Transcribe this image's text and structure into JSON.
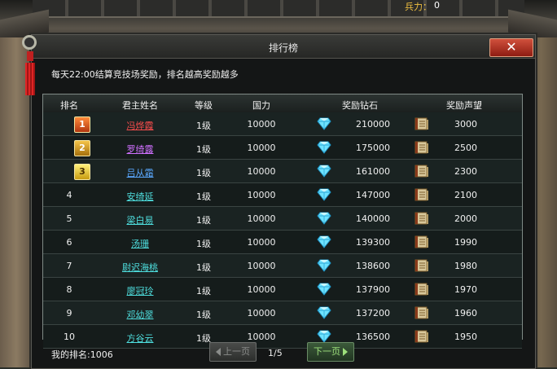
{
  "hud": {
    "soldier_label": "兵力：",
    "soldier_value": "0"
  },
  "window": {
    "title": "排行榜",
    "close_symbol": "✕"
  },
  "notice": "每天22:00结算竞技场奖励，排名越高奖励越多",
  "table": {
    "headers": {
      "rank": "排名",
      "name": "君主姓名",
      "level": "等级",
      "power": "国力",
      "diamond": "奖励钻石",
      "reputation": "奖励声望"
    },
    "rows": [
      {
        "rank": "1",
        "name": "冯烨霞",
        "name_color": "#ff4d4d",
        "level": "1级",
        "power": "10000",
        "diamond": "210000",
        "reputation": "3000"
      },
      {
        "rank": "2",
        "name": "罗绮露",
        "name_color": "#d070ff",
        "level": "1级",
        "power": "10000",
        "diamond": "175000",
        "reputation": "2500"
      },
      {
        "rank": "3",
        "name": "吕从霜",
        "name_color": "#5aa8ff",
        "level": "1级",
        "power": "10000",
        "diamond": "161000",
        "reputation": "2300"
      },
      {
        "rank": "4",
        "name": "安绮延",
        "name_color": "#4fe0e0",
        "level": "1级",
        "power": "10000",
        "diamond": "147000",
        "reputation": "2100"
      },
      {
        "rank": "5",
        "name": "梁白易",
        "name_color": "#4fe0e0",
        "level": "1级",
        "power": "10000",
        "diamond": "140000",
        "reputation": "2000"
      },
      {
        "rank": "6",
        "name": "汤珊",
        "name_color": "#4fe0e0",
        "level": "1级",
        "power": "10000",
        "diamond": "139300",
        "reputation": "1990"
      },
      {
        "rank": "7",
        "name": "尉迟海桃",
        "name_color": "#4fe0e0",
        "level": "1级",
        "power": "10000",
        "diamond": "138600",
        "reputation": "1980"
      },
      {
        "rank": "8",
        "name": "廖冠玲",
        "name_color": "#4fe0e0",
        "level": "1级",
        "power": "10000",
        "diamond": "137900",
        "reputation": "1970"
      },
      {
        "rank": "9",
        "name": "邓幼翠",
        "name_color": "#4fe0e0",
        "level": "1级",
        "power": "10000",
        "diamond": "137200",
        "reputation": "1960"
      },
      {
        "rank": "10",
        "name": "方谷云",
        "name_color": "#4fe0e0",
        "level": "1级",
        "power": "10000",
        "diamond": "136500",
        "reputation": "1950"
      }
    ]
  },
  "footer": {
    "my_rank": "我的排名:1006",
    "prev_label": "上一页",
    "page_indicator": "1/5",
    "next_label": "下一页"
  },
  "icons": {
    "diamond": "diamond-icon",
    "reputation": "book-icon",
    "close": "close-icon"
  }
}
